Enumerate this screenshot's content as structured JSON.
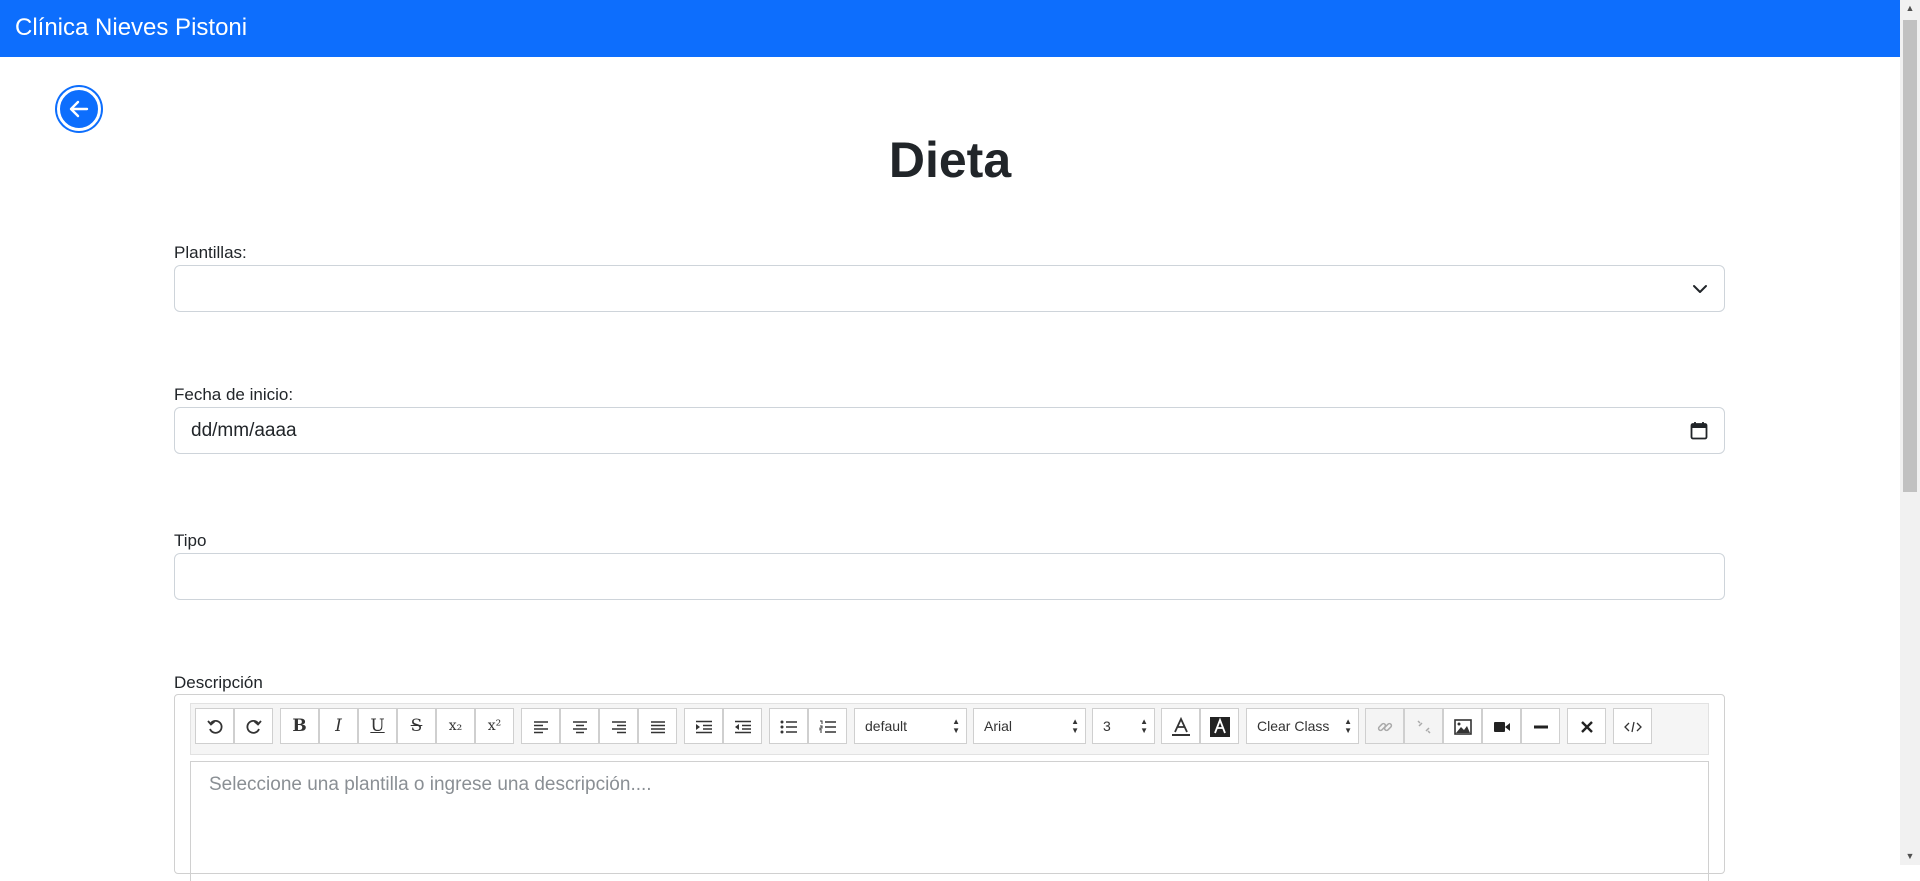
{
  "header": {
    "brand": "Clínica Nieves Pistoni"
  },
  "page": {
    "title": "Dieta"
  },
  "form": {
    "plantillas_label": "Plantillas:",
    "plantillas_value": "",
    "fecha_label": "Fecha de inicio:",
    "fecha_value": "dd/mm/aaaa",
    "tipo_label": "Tipo",
    "tipo_value": "",
    "descripcion_label": "Descripción"
  },
  "editor": {
    "placeholder": "Seleccione una plantilla o ingrese una descripción....",
    "style_select": "default",
    "font_select": "Arial",
    "size_select": "3",
    "class_select": "Clear Class",
    "buttons": {
      "bold": "B",
      "italic": "I",
      "underline": "U",
      "strike": "S",
      "subscript": "x₂",
      "superscript": "x²"
    }
  },
  "colors": {
    "primary": "#0d6efd"
  }
}
